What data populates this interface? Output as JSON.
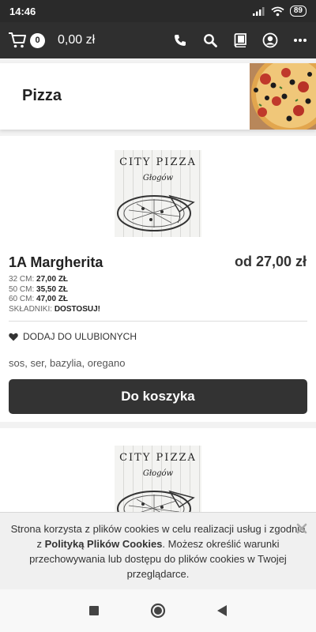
{
  "status_bar": {
    "time": "14:46",
    "battery": "89"
  },
  "app_bar": {
    "cart_count": "0",
    "cart_total": "0,00 zł"
  },
  "category": {
    "title": "Pizza"
  },
  "logo": {
    "title": "CITY PIZZA",
    "subtitle": "Głogów"
  },
  "product": {
    "name": "1A Margherita",
    "price": "od 27,00 zł",
    "variants": [
      {
        "label": "32 CM:",
        "value": "27,00 ZŁ"
      },
      {
        "label": "50 CM:",
        "value": "35,50 ZŁ"
      },
      {
        "label": "60 CM:",
        "value": "47,00 ZŁ"
      }
    ],
    "ingredients_label": "SKŁADNIKI:",
    "ingredients_action": "DOSTOSUJ!",
    "favorite_label": "DODAJ DO ULUBIONYCH",
    "description": "sos, ser, bazylia, oregano",
    "add_button": "Do koszyka"
  },
  "cookie_banner": {
    "text_1": "Strona korzysta z plików cookies w celu realizacji usług i zgodnie z ",
    "link": "Polityką Plików Cookies",
    "text_2": ". Możesz określić warunki przechowywania lub dostępu do plików cookies w Twojej przeglądarce."
  },
  "colors": {
    "appbar": "#2f2f2f",
    "button": "#333333",
    "card": "#ffffff",
    "background": "#f2f2f2"
  }
}
